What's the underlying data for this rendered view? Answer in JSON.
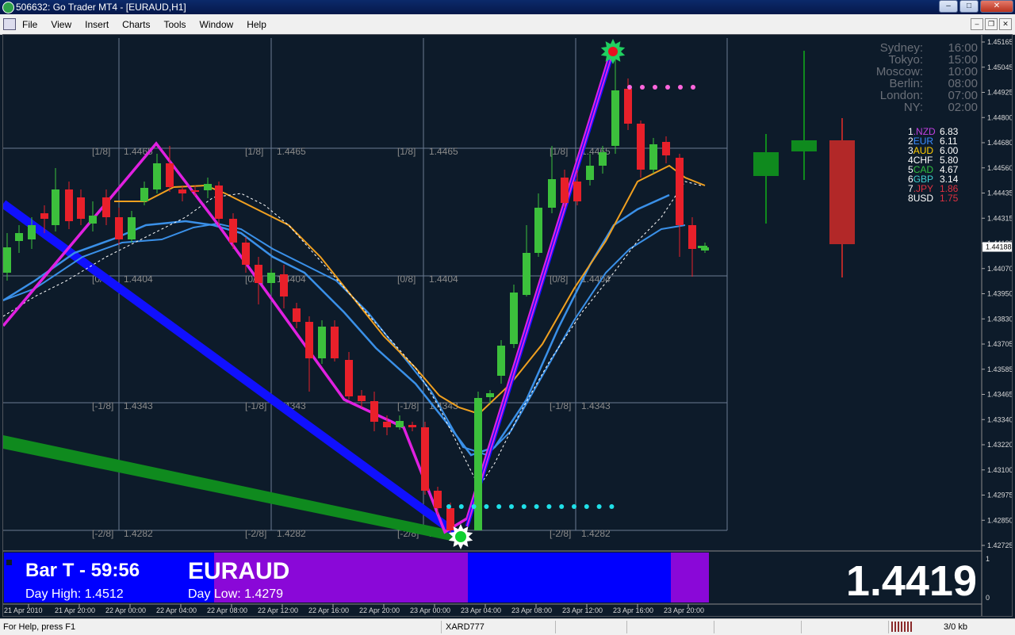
{
  "window": {
    "title": "506632: Go Trader MT4 - [EURAUD,H1]"
  },
  "menu": [
    "File",
    "View",
    "Insert",
    "Charts",
    "Tools",
    "Window",
    "Help"
  ],
  "chart": {
    "symbol": "EURAUD",
    "price_axis": [
      "1.45165",
      "1.45045",
      "1.44925",
      "1.44800",
      "1.44680",
      "1.44560",
      "1.44435",
      "1.44315",
      "1.44188",
      "1.44070",
      "1.43950",
      "1.43830",
      "1.43705",
      "1.43585",
      "1.43465",
      "1.43340",
      "1.43220",
      "1.43100",
      "1.42975",
      "1.42850",
      "1.42725"
    ],
    "current_price_label": "1.44188",
    "time_axis": [
      "21 Apr 2010",
      "21 Apr 20:00",
      "22 Apr 00:00",
      "22 Apr 04:00",
      "22 Apr 08:00",
      "22 Apr 12:00",
      "22 Apr 16:00",
      "22 Apr 20:00",
      "23 Apr 00:00",
      "23 Apr 04:00",
      "23 Apr 08:00",
      "23 Apr 12:00",
      "23 Apr 16:00",
      "23 Apr 20:00"
    ],
    "murrey_levels": [
      {
        "tag": "[1/8]",
        "price": "1.4465"
      },
      {
        "tag": "[0/8]",
        "price": "1.4404"
      },
      {
        "tag": "[-1/8]",
        "price": "1.4343"
      },
      {
        "tag": "[-2/8]",
        "price": "1.4282"
      }
    ],
    "market_clocks": [
      {
        "city": "Sydney:",
        "time": "16:00"
      },
      {
        "city": "Tokyo:",
        "time": "15:00"
      },
      {
        "city": "Moscow:",
        "time": "10:00"
      },
      {
        "city": "Berlin:",
        "time": "08:00"
      },
      {
        "city": "London:",
        "time": "07:00"
      },
      {
        "city": "NY:",
        "time": "02:00"
      }
    ],
    "currency_strength": [
      {
        "rank": "1.",
        "code": "NZD",
        "value": "6.83",
        "code_color": "#c040e0",
        "value_color": "#ffffff"
      },
      {
        "rank": "2.",
        "code": "EUR",
        "value": "6.11",
        "code_color": "#3a8cff",
        "value_color": "#ffffff"
      },
      {
        "rank": "3.",
        "code": "AUD",
        "value": "6.00",
        "code_color": "#ffcc00",
        "value_color": "#ffffff"
      },
      {
        "rank": "4.",
        "code": "CHF",
        "value": "5.80",
        "code_color": "#ffffff",
        "value_color": "#ffffff"
      },
      {
        "rank": "5.",
        "code": "CAD",
        "value": "4.67",
        "code_color": "#30c040",
        "value_color": "#ffffff"
      },
      {
        "rank": "6.",
        "code": "GBP",
        "value": "3.14",
        "code_color": "#40d0d0",
        "value_color": "#ffffff"
      },
      {
        "rank": "7.",
        "code": "JPY",
        "value": "1.86",
        "code_color": "#e03040",
        "value_color": "#e03040"
      },
      {
        "rank": "8.",
        "code": "USD",
        "value": "1.75",
        "code_color": "#ffffff",
        "value_color": "#e03040"
      }
    ]
  },
  "info_panel": {
    "bar_timer": "Bar T - 59:56",
    "day_high": "Day High: 1.4512",
    "symbol": "EURAUD",
    "day_low": "Day Low: 1.4279",
    "big_price": "1.4419",
    "sub_axis_top": "1",
    "sub_axis_bottom": "0"
  },
  "status": {
    "help": "For Help, press F1",
    "profile": "XARD777",
    "traffic": "3/0 kb"
  },
  "colors": {
    "bull": "#3cc03c",
    "bear": "#e8202a",
    "magenta": "#e020e0",
    "trend_blue": "#1010ff",
    "trend_green": "#0f8a1e",
    "ma_orange": "#f0a020",
    "ma_blue": "#3a90e8",
    "panel_blue": "#0000ff",
    "panel_purple": "#8a08d8"
  }
}
